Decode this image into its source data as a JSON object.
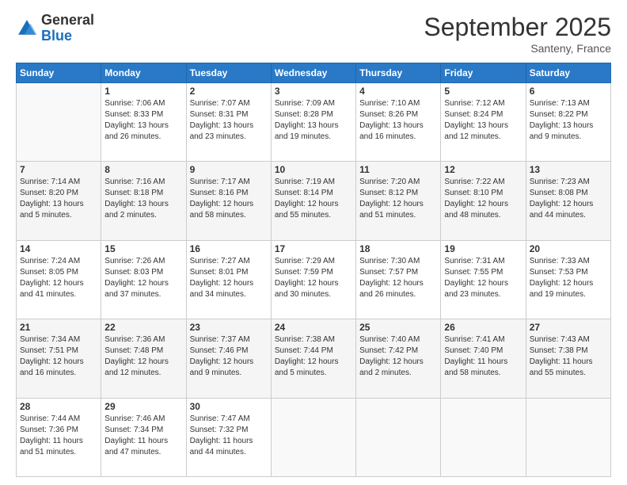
{
  "header": {
    "logo_general": "General",
    "logo_blue": "Blue",
    "month_title": "September 2025",
    "location": "Santeny, France"
  },
  "calendar": {
    "days_of_week": [
      "Sunday",
      "Monday",
      "Tuesday",
      "Wednesday",
      "Thursday",
      "Friday",
      "Saturday"
    ],
    "weeks": [
      [
        {
          "day": "",
          "info": ""
        },
        {
          "day": "1",
          "info": "Sunrise: 7:06 AM\nSunset: 8:33 PM\nDaylight: 13 hours\nand 26 minutes."
        },
        {
          "day": "2",
          "info": "Sunrise: 7:07 AM\nSunset: 8:31 PM\nDaylight: 13 hours\nand 23 minutes."
        },
        {
          "day": "3",
          "info": "Sunrise: 7:09 AM\nSunset: 8:28 PM\nDaylight: 13 hours\nand 19 minutes."
        },
        {
          "day": "4",
          "info": "Sunrise: 7:10 AM\nSunset: 8:26 PM\nDaylight: 13 hours\nand 16 minutes."
        },
        {
          "day": "5",
          "info": "Sunrise: 7:12 AM\nSunset: 8:24 PM\nDaylight: 13 hours\nand 12 minutes."
        },
        {
          "day": "6",
          "info": "Sunrise: 7:13 AM\nSunset: 8:22 PM\nDaylight: 13 hours\nand 9 minutes."
        }
      ],
      [
        {
          "day": "7",
          "info": "Sunrise: 7:14 AM\nSunset: 8:20 PM\nDaylight: 13 hours\nand 5 minutes."
        },
        {
          "day": "8",
          "info": "Sunrise: 7:16 AM\nSunset: 8:18 PM\nDaylight: 13 hours\nand 2 minutes."
        },
        {
          "day": "9",
          "info": "Sunrise: 7:17 AM\nSunset: 8:16 PM\nDaylight: 12 hours\nand 58 minutes."
        },
        {
          "day": "10",
          "info": "Sunrise: 7:19 AM\nSunset: 8:14 PM\nDaylight: 12 hours\nand 55 minutes."
        },
        {
          "day": "11",
          "info": "Sunrise: 7:20 AM\nSunset: 8:12 PM\nDaylight: 12 hours\nand 51 minutes."
        },
        {
          "day": "12",
          "info": "Sunrise: 7:22 AM\nSunset: 8:10 PM\nDaylight: 12 hours\nand 48 minutes."
        },
        {
          "day": "13",
          "info": "Sunrise: 7:23 AM\nSunset: 8:08 PM\nDaylight: 12 hours\nand 44 minutes."
        }
      ],
      [
        {
          "day": "14",
          "info": "Sunrise: 7:24 AM\nSunset: 8:05 PM\nDaylight: 12 hours\nand 41 minutes."
        },
        {
          "day": "15",
          "info": "Sunrise: 7:26 AM\nSunset: 8:03 PM\nDaylight: 12 hours\nand 37 minutes."
        },
        {
          "day": "16",
          "info": "Sunrise: 7:27 AM\nSunset: 8:01 PM\nDaylight: 12 hours\nand 34 minutes."
        },
        {
          "day": "17",
          "info": "Sunrise: 7:29 AM\nSunset: 7:59 PM\nDaylight: 12 hours\nand 30 minutes."
        },
        {
          "day": "18",
          "info": "Sunrise: 7:30 AM\nSunset: 7:57 PM\nDaylight: 12 hours\nand 26 minutes."
        },
        {
          "day": "19",
          "info": "Sunrise: 7:31 AM\nSunset: 7:55 PM\nDaylight: 12 hours\nand 23 minutes."
        },
        {
          "day": "20",
          "info": "Sunrise: 7:33 AM\nSunset: 7:53 PM\nDaylight: 12 hours\nand 19 minutes."
        }
      ],
      [
        {
          "day": "21",
          "info": "Sunrise: 7:34 AM\nSunset: 7:51 PM\nDaylight: 12 hours\nand 16 minutes."
        },
        {
          "day": "22",
          "info": "Sunrise: 7:36 AM\nSunset: 7:48 PM\nDaylight: 12 hours\nand 12 minutes."
        },
        {
          "day": "23",
          "info": "Sunrise: 7:37 AM\nSunset: 7:46 PM\nDaylight: 12 hours\nand 9 minutes."
        },
        {
          "day": "24",
          "info": "Sunrise: 7:38 AM\nSunset: 7:44 PM\nDaylight: 12 hours\nand 5 minutes."
        },
        {
          "day": "25",
          "info": "Sunrise: 7:40 AM\nSunset: 7:42 PM\nDaylight: 12 hours\nand 2 minutes."
        },
        {
          "day": "26",
          "info": "Sunrise: 7:41 AM\nSunset: 7:40 PM\nDaylight: 11 hours\nand 58 minutes."
        },
        {
          "day": "27",
          "info": "Sunrise: 7:43 AM\nSunset: 7:38 PM\nDaylight: 11 hours\nand 55 minutes."
        }
      ],
      [
        {
          "day": "28",
          "info": "Sunrise: 7:44 AM\nSunset: 7:36 PM\nDaylight: 11 hours\nand 51 minutes."
        },
        {
          "day": "29",
          "info": "Sunrise: 7:46 AM\nSunset: 7:34 PM\nDaylight: 11 hours\nand 47 minutes."
        },
        {
          "day": "30",
          "info": "Sunrise: 7:47 AM\nSunset: 7:32 PM\nDaylight: 11 hours\nand 44 minutes."
        },
        {
          "day": "",
          "info": ""
        },
        {
          "day": "",
          "info": ""
        },
        {
          "day": "",
          "info": ""
        },
        {
          "day": "",
          "info": ""
        }
      ]
    ]
  }
}
